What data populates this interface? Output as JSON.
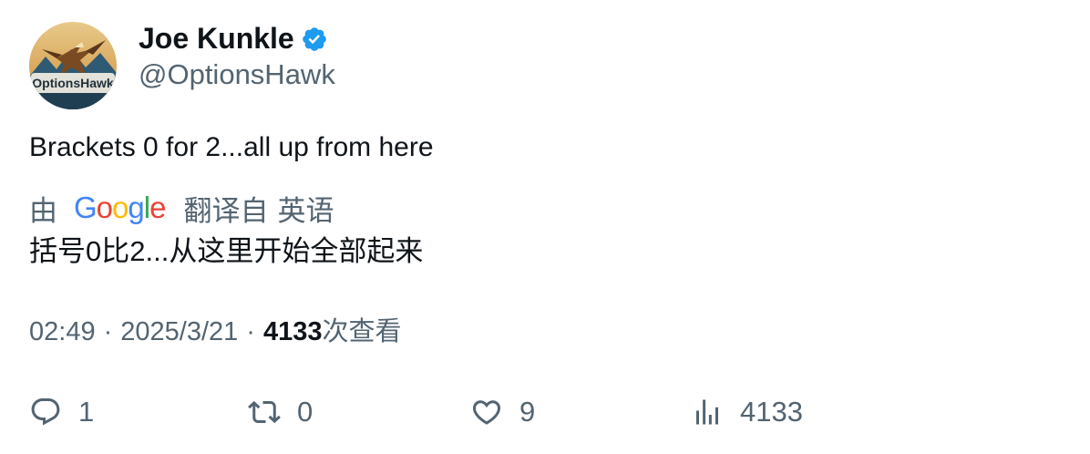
{
  "author": {
    "display_name": "Joe Kunkle",
    "handle": "@OptionsHawk",
    "verified": true,
    "avatar_text": "OptionsHawk"
  },
  "tweet": {
    "text": "Brackets 0 for 2...all up from here"
  },
  "translation": {
    "by_label": "由",
    "provider": "Google",
    "translated_from_label": "翻译自",
    "source_language": "英语",
    "text": "括号0比2...从这里开始全部起来"
  },
  "meta": {
    "time": "02:49",
    "separator": "·",
    "date": "2025/3/21",
    "views_count": "4133",
    "views_label": "次查看"
  },
  "actions": {
    "reply_count": "1",
    "retweet_count": "0",
    "like_count": "9",
    "views_count": "4133"
  },
  "colors": {
    "text_primary": "#0f1419",
    "text_secondary": "#536471",
    "verified_blue": "#1d9bf0"
  },
  "icons": {
    "reply": "reply-icon",
    "retweet": "retweet-icon",
    "like": "heart-icon",
    "views": "analytics-icon",
    "verified": "verified-badge-icon"
  }
}
